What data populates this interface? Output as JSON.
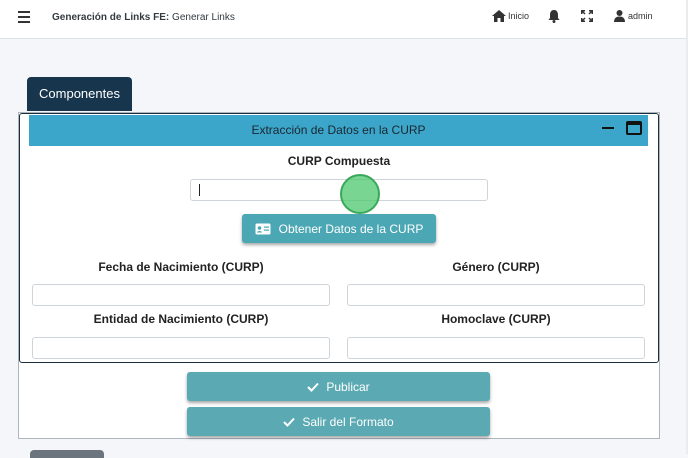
{
  "header": {
    "title_bold": "Generación de Links FE:",
    "title_rest": " Generar Links",
    "inicio_label": "Inicio",
    "user_label": "admin"
  },
  "tab": {
    "label": "Componentes"
  },
  "card": {
    "title": "Extracción de Datos en la CURP",
    "curp_label": "CURP Compuesta",
    "curp_value": "",
    "obtener_button": "Obtener Datos de la CURP",
    "fecha_label": "Fecha de Nacimiento (CURP)",
    "genero_label": "Género (CURP)",
    "entidad_label": "Entidad de Nacimiento (CURP)",
    "homoclave_label": "Homoclave (CURP)"
  },
  "actions": {
    "publicar": "Publicar",
    "salir": "Salir del Formato"
  },
  "colors": {
    "card_header": "#3ba6c9",
    "tab": "#17364d",
    "button": "#5aa9b3"
  },
  "icons": [
    "menu-icon",
    "home-icon",
    "bell-icon",
    "expand-icon",
    "user-icon",
    "id-card-icon",
    "check-icon",
    "minimize-icon",
    "maximize-icon"
  ]
}
